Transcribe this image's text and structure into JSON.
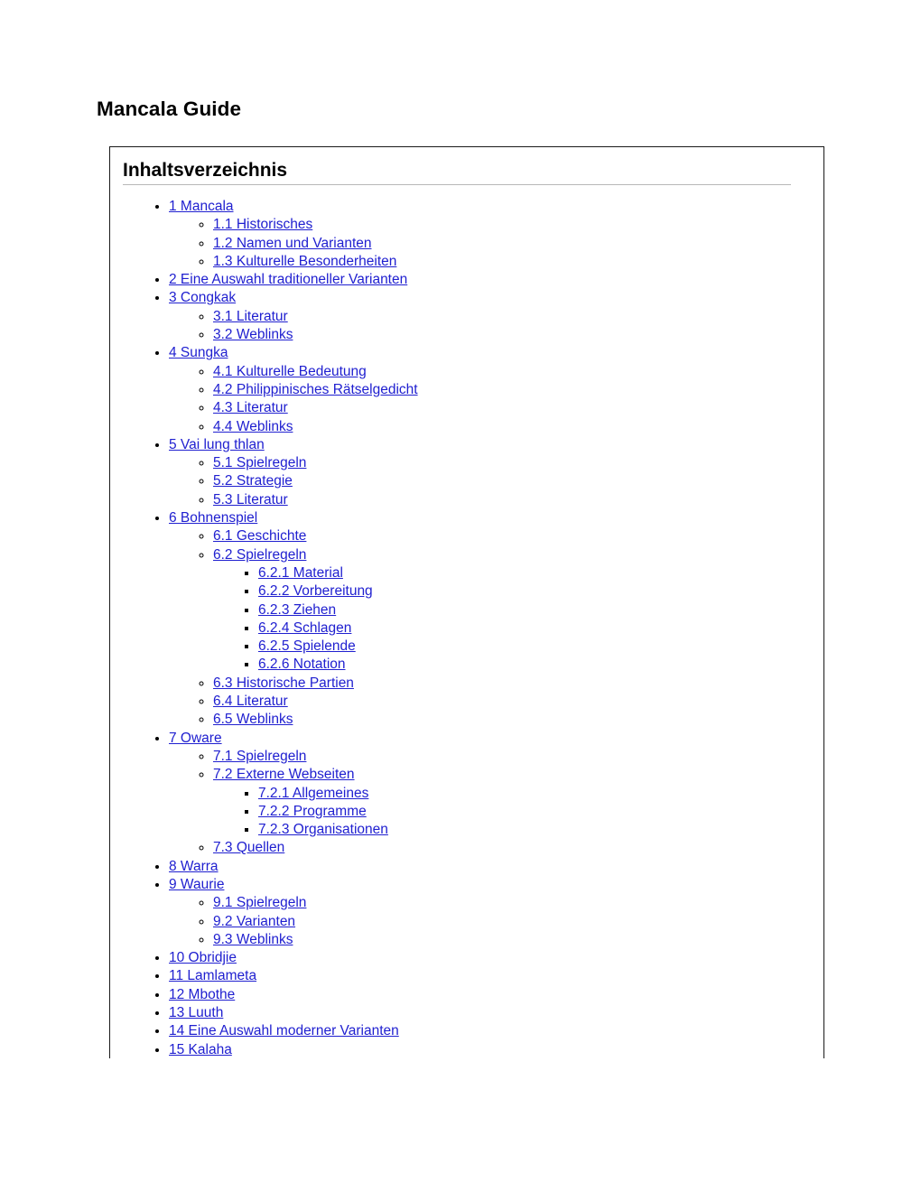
{
  "page": {
    "title": "Mancala Guide"
  },
  "toc": {
    "heading": "Inhaltsverzeichnis",
    "link_color": "#2020d0",
    "box_border_color": "#1a1a1a",
    "heading_rule_color": "#b8b8b8",
    "items": [
      {
        "label": "1 Mancala",
        "children": [
          {
            "label": "1.1 Historisches"
          },
          {
            "label": "1.2 Namen und Varianten"
          },
          {
            "label": "1.3 Kulturelle Besonderheiten"
          }
        ]
      },
      {
        "label": "2 Eine Auswahl traditioneller Varianten",
        "children": []
      },
      {
        "label": "3 Congkak",
        "children": [
          {
            "label": "3.1 Literatur"
          },
          {
            "label": "3.2 Weblinks"
          }
        ]
      },
      {
        "label": "4 Sungka",
        "children": [
          {
            "label": "4.1 Kulturelle Bedeutung"
          },
          {
            "label": "4.2 Philippinisches Rätselgedicht"
          },
          {
            "label": "4.3 Literatur"
          },
          {
            "label": "4.4 Weblinks"
          }
        ]
      },
      {
        "label": "5 Vai lung thlan",
        "children": [
          {
            "label": "5.1 Spielregeln"
          },
          {
            "label": "5.2 Strategie"
          },
          {
            "label": "5.3 Literatur"
          }
        ]
      },
      {
        "label": "6 Bohnenspiel",
        "children": [
          {
            "label": "6.1 Geschichte"
          },
          {
            "label": "6.2 Spielregeln",
            "children": [
              {
                "label": "6.2.1 Material"
              },
              {
                "label": "6.2.2 Vorbereitung"
              },
              {
                "label": "6.2.3 Ziehen"
              },
              {
                "label": "6.2.4 Schlagen"
              },
              {
                "label": "6.2.5 Spielende"
              },
              {
                "label": "6.2.6 Notation"
              }
            ]
          },
          {
            "label": "6.3 Historische Partien"
          },
          {
            "label": "6.4 Literatur"
          },
          {
            "label": "6.5 Weblinks"
          }
        ]
      },
      {
        "label": "7 Oware",
        "children": [
          {
            "label": "7.1 Spielregeln"
          },
          {
            "label": "7.2 Externe Webseiten",
            "children": [
              {
                "label": "7.2.1 Allgemeines"
              },
              {
                "label": "7.2.2 Programme"
              },
              {
                "label": "7.2.3 Organisationen"
              }
            ]
          },
          {
            "label": "7.3 Quellen"
          }
        ]
      },
      {
        "label": "8 Warra",
        "children": []
      },
      {
        "label": "9 Waurie",
        "children": [
          {
            "label": "9.1 Spielregeln"
          },
          {
            "label": "9.2 Varianten"
          },
          {
            "label": "9.3 Weblinks"
          }
        ]
      },
      {
        "label": "10 Obridjie",
        "children": []
      },
      {
        "label": "11 Lamlameta",
        "children": []
      },
      {
        "label": "12 Mbothe",
        "children": []
      },
      {
        "label": "13 Luuth",
        "children": []
      },
      {
        "label": "14 Eine Auswahl moderner Varianten",
        "children": []
      },
      {
        "label": "15 Kalaha",
        "children": []
      }
    ]
  }
}
